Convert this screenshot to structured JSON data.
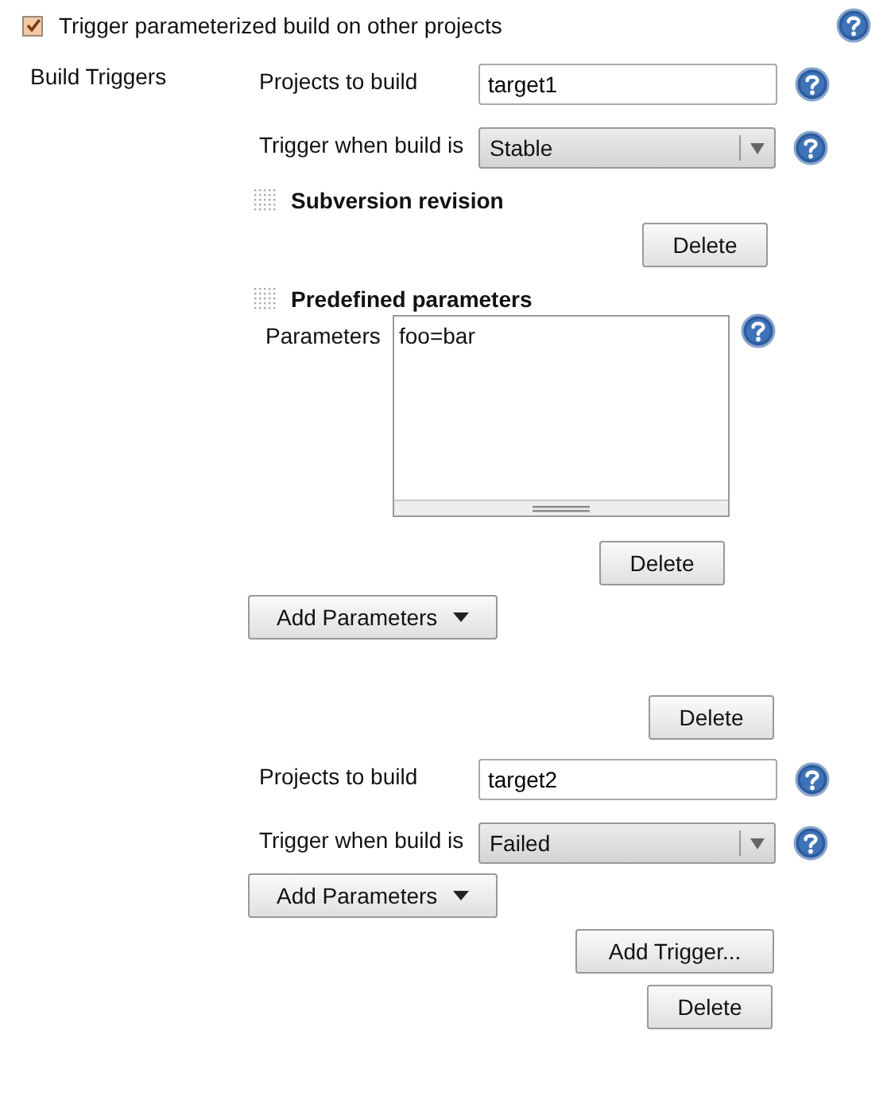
{
  "header": {
    "label": "Trigger parameterized build on other projects",
    "checked": true
  },
  "section_label": "Build Triggers",
  "triggers": [
    {
      "fields": [
        {
          "kind": "text",
          "label": "Projects to build",
          "value": "target1"
        },
        {
          "kind": "select",
          "label": "Trigger when build is",
          "value": "Stable"
        }
      ],
      "parameters": [
        {
          "kind": "plain",
          "title": "Subversion revision",
          "delete": "Delete"
        },
        {
          "kind": "textarea",
          "title": "Predefined parameters",
          "label": "Parameters",
          "value": "foo=bar",
          "delete": "Delete"
        }
      ],
      "add_parameters": "Add Parameters",
      "delete": "Delete"
    },
    {
      "fields": [
        {
          "kind": "text",
          "label": "Projects to build",
          "value": "target2"
        },
        {
          "kind": "select",
          "label": "Trigger when build is",
          "value": "Failed"
        }
      ],
      "add_parameters": "Add Parameters"
    }
  ],
  "add_trigger": "Add Trigger...",
  "delete": "Delete"
}
